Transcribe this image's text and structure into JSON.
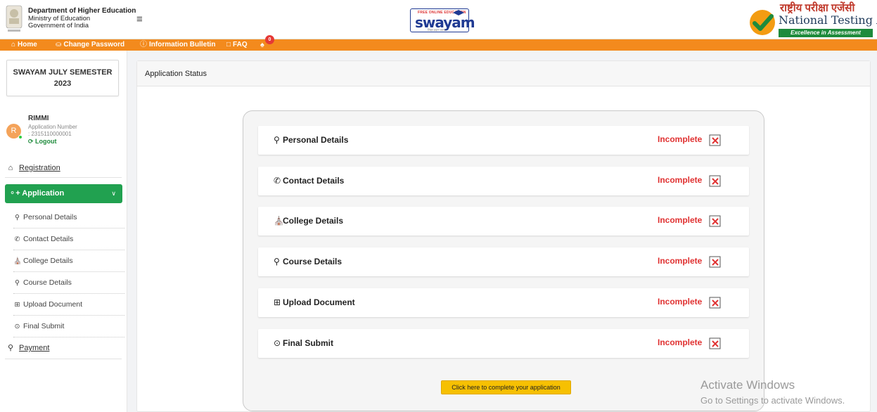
{
  "header": {
    "dept_line1": "Department of Higher Education",
    "dept_line2": "Ministry of Education",
    "dept_line3": "Government of India",
    "swayam_tag": "FREE ONLINE EDUCATION",
    "swayam_word": "swayam",
    "swayam_sub": "शिक्षा प्रदान करना",
    "nta_hindi": "राष्ट्रीय परीक्षा एजेंसी",
    "nta_english": "National Testing Agency",
    "nta_tagline": "Excellence in Assessment",
    "colors": {
      "nav_orange": "#f38a1d",
      "green": "#21a150",
      "red": "#e03131",
      "yellow": "#f6c002"
    }
  },
  "nav": {
    "home": "Home",
    "change_password": "Change Password",
    "information_bulletin": "Information Bulletin",
    "faq": "FAQ",
    "notification_count": "0"
  },
  "sidebar": {
    "semester": "SWAYAM JULY SEMESTER 2023",
    "avatar_letter": "R",
    "user_name": "RIMMI",
    "app_number_label": "Application Number",
    "app_number": ": 2315110000001",
    "logout": "Logout",
    "registration": "Registration",
    "application": "Application",
    "sub_items": [
      {
        "label": "Personal Details",
        "icon": "user-icon"
      },
      {
        "label": "Contact Details",
        "icon": "phone-icon"
      },
      {
        "label": "College Details",
        "icon": "bank-icon"
      },
      {
        "label": "Course Details",
        "icon": "award-icon"
      },
      {
        "label": "Upload Document",
        "icon": "upload-icon"
      },
      {
        "label": "Final Submit",
        "icon": "check-circle-icon"
      }
    ],
    "payment": "Payment"
  },
  "main": {
    "page_title": "Application Status",
    "rows": [
      {
        "title": "Personal Details",
        "status": "Incomplete",
        "icon": "user-icon"
      },
      {
        "title": "Contact Details",
        "status": "Incomplete",
        "icon": "phone-icon"
      },
      {
        "title": "College Details",
        "status": "Incomplete",
        "icon": "bank-icon"
      },
      {
        "title": "Course Details",
        "status": "Incomplete",
        "icon": "award-icon"
      },
      {
        "title": "Upload Document",
        "status": "Incomplete",
        "icon": "upload-icon"
      },
      {
        "title": "Final Submit",
        "status": "Incomplete",
        "icon": "check-circle-icon"
      }
    ],
    "cta_label": "Click here to complete your application"
  },
  "watermark": {
    "line1": "Activate Windows",
    "line2": "Go to Settings to activate Windows."
  }
}
